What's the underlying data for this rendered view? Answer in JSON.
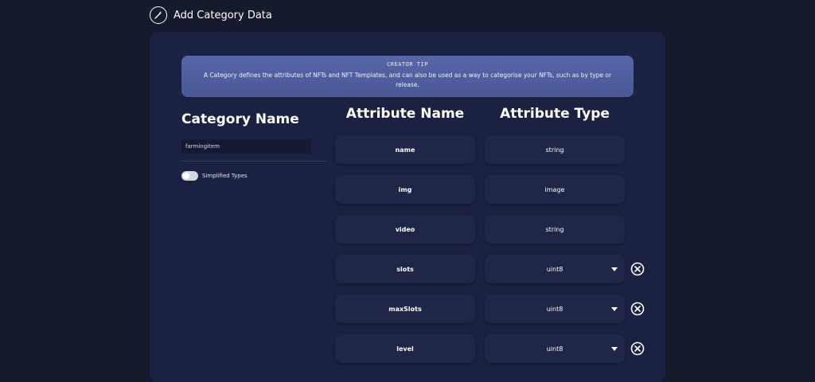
{
  "header": {
    "title": "Add Category Data",
    "icon": "magic-wand-icon"
  },
  "tip": {
    "title": "CREATOR TIP",
    "text": "A Category defines the attributes of NFTs and NFT Templates, and can also be used as a way to categorise your NFTs, such as by type or release."
  },
  "category": {
    "label": "Category Name",
    "value": "farmingitem",
    "toggle_label": "Simplified Types",
    "toggle_on": false
  },
  "columns": {
    "name": "Attribute Name",
    "type": "Attribute Type"
  },
  "attributes": [
    {
      "name": "name",
      "type": "string",
      "editable": false
    },
    {
      "name": "img",
      "type": "image",
      "editable": false
    },
    {
      "name": "video",
      "type": "string",
      "editable": false
    },
    {
      "name": "slots",
      "type": "uint8",
      "editable": true
    },
    {
      "name": "maxSlots",
      "type": "uint8",
      "editable": true
    },
    {
      "name": "level",
      "type": "uint8",
      "editable": true
    }
  ],
  "colors": {
    "background": "#151a2d",
    "card": "#1b2140",
    "cell": "#1f2647",
    "tip_accent": "#5666a8"
  }
}
